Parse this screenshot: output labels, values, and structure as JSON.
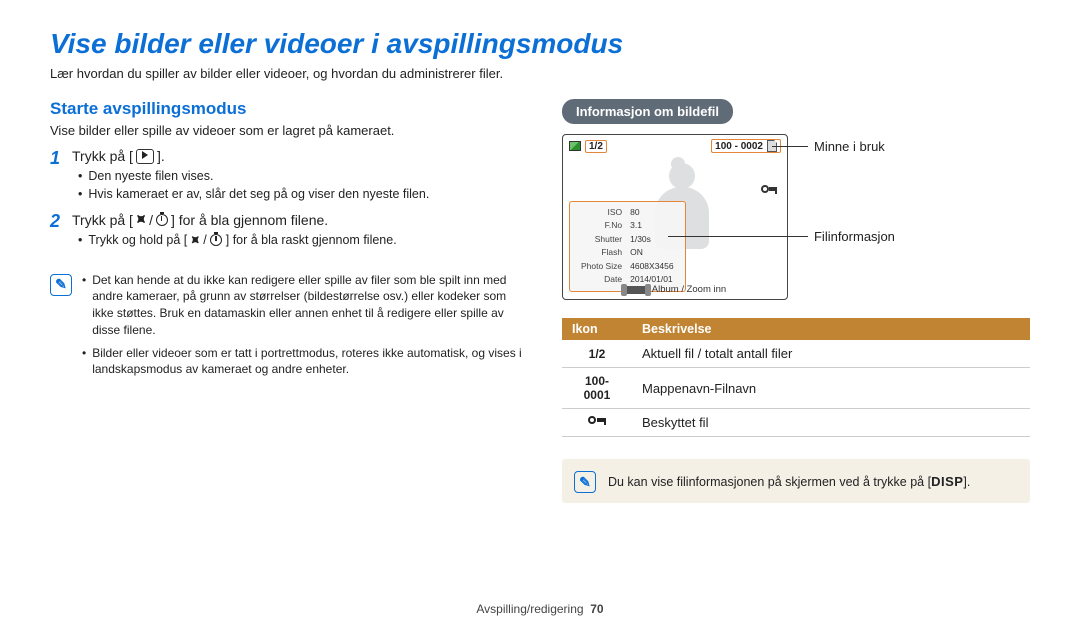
{
  "title": "Vise bilder eller videoer i avspillingsmodus",
  "subtitle": "Lær hvordan du spiller av bilder eller videoer, og hvordan du administrerer filer.",
  "left": {
    "heading": "Starte avspillingsmodus",
    "intro": "Vise bilder eller spille av videoer som er lagret på kameraet.",
    "step1": {
      "num": "1",
      "text_a": "Trykk på [",
      "text_b": "].",
      "bullets": [
        "Den nyeste filen vises.",
        "Hvis kameraet er av, slår det seg på og viser den nyeste filen."
      ]
    },
    "step2": {
      "num": "2",
      "text_a": "Trykk på [",
      "text_mid": "/",
      "text_b": "] for å bla gjennom filene.",
      "bullet_a": "Trykk og hold på [",
      "bullet_mid": "/",
      "bullet_b": "] for å bla raskt gjennom filene."
    },
    "notes": [
      "Det kan hende at du ikke kan redigere eller spille av filer som ble spilt inn med andre kameraer, på grunn av størrelser (bildestørrelse osv.) eller kodeker som ikke støttes. Bruk en datamaskin eller annen enhet til å redigere eller spille av disse filene.",
      "Bilder eller videoer som er tatt i portrettmodus, roteres ikke automatisk, og vises i landskapsmodus av kameraet og andre enheter."
    ]
  },
  "right": {
    "pill": "Informasjon om bildefil",
    "screen": {
      "count": "1/2",
      "folder": "100 - 0002",
      "info_rows": [
        [
          "ISO",
          "80"
        ],
        [
          "F.No",
          "3.1"
        ],
        [
          "Shutter",
          "1/30s"
        ],
        [
          "Flash",
          "ON"
        ],
        [
          "Photo Size",
          "4608X3456"
        ],
        [
          "Date",
          "2014/01/01"
        ]
      ],
      "bottom": "Album / Zoom inn"
    },
    "callouts": {
      "mem": "Minne i bruk",
      "fileinfo": "Filinformasjon"
    },
    "table": {
      "h1": "Ikon",
      "h2": "Beskrivelse",
      "rows": [
        {
          "icon": "1/2",
          "desc": "Aktuell fil / totalt antall filer"
        },
        {
          "icon": "100-0001",
          "desc": "Mappenavn-Filnavn"
        },
        {
          "icon": "__KEY__",
          "desc": "Beskyttet fil"
        }
      ]
    },
    "tip_a": "Du kan vise filinformasjonen på skjermen ved å trykke på [",
    "tip_b": "].",
    "disp": "DISP"
  },
  "footer": {
    "section": "Avspilling/redigering",
    "page": "70"
  }
}
